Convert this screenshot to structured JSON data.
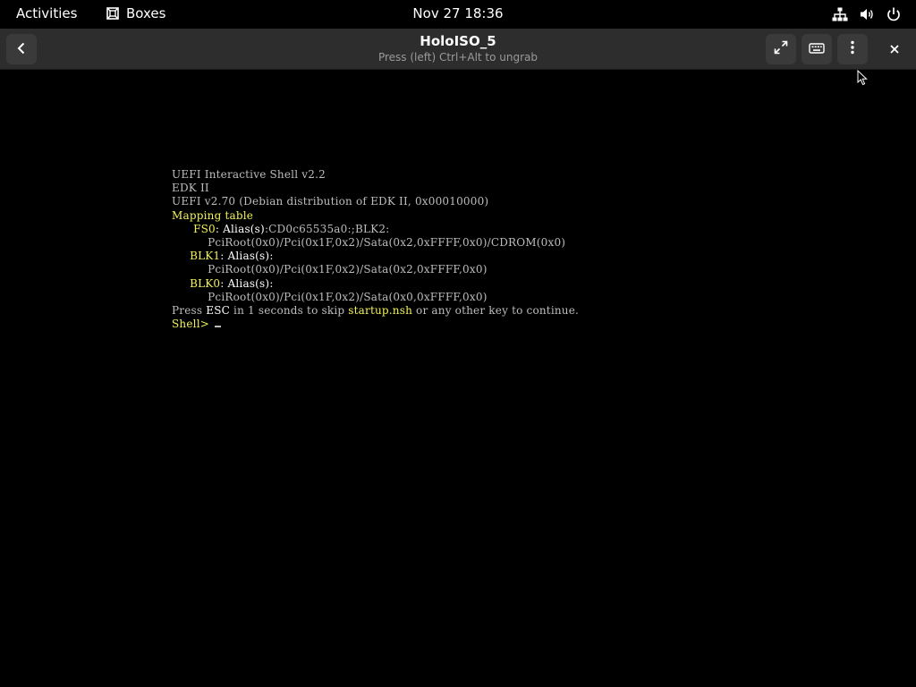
{
  "topbar": {
    "activities": "Activities",
    "app_name": "Boxes",
    "app_icon": "boxes-icon",
    "clock": "Nov 27  18:36",
    "status_icons": [
      "network-icon",
      "volume-icon",
      "power-icon"
    ]
  },
  "headerbar": {
    "back_icon": "back-arrow-icon",
    "title": "HoloISO_5",
    "subtitle": "Press (left) Ctrl+Alt to ungrab",
    "buttons": [
      "fullscreen-icon",
      "keyboard-icon",
      "menu-icon",
      "close-icon"
    ]
  },
  "terminal": {
    "line1": "UEFI Interactive Shell v2.2",
    "line2": "EDK II",
    "line3": "UEFI v2.70 (Debian distribution of EDK II, 0x00010000)",
    "mapping_header": "Mapping table",
    "fs0_label": "FS0",
    "fs0_alias_label": ": Alias(s)",
    "fs0_alias": ":CD0c65535a0:;BLK2:",
    "fs0_path": "PciRoot(0x0)/Pci(0x1F,0x2)/Sata(0x2,0xFFFF,0x0)/CDROM(0x0)",
    "blk1_label": "BLK1",
    "blk1_alias_label": ": Alias(s)",
    "blk1_alias": ":",
    "blk1_path": "PciRoot(0x0)/Pci(0x1F,0x2)/Sata(0x2,0xFFFF,0x0)",
    "blk0_label": "BLK0",
    "blk0_alias_label": ": Alias(s)",
    "blk0_alias": ":",
    "blk0_path": "PciRoot(0x0)/Pci(0x1F,0x2)/Sata(0x0,0xFFFF,0x0)",
    "press_prefix": "Press ",
    "press_esc": "ESC",
    "press_middle": " in 1 seconds to skip ",
    "press_startup": "startup.nsh",
    "press_suffix": " or any other key to continue.",
    "prompt": "Shell>"
  },
  "colors": {
    "topbar_bg": "#000000",
    "headerbar_bg": "#2d2d2d",
    "terminal_text": "#bdbdbd",
    "terminal_highlight": "#f2f25a"
  }
}
